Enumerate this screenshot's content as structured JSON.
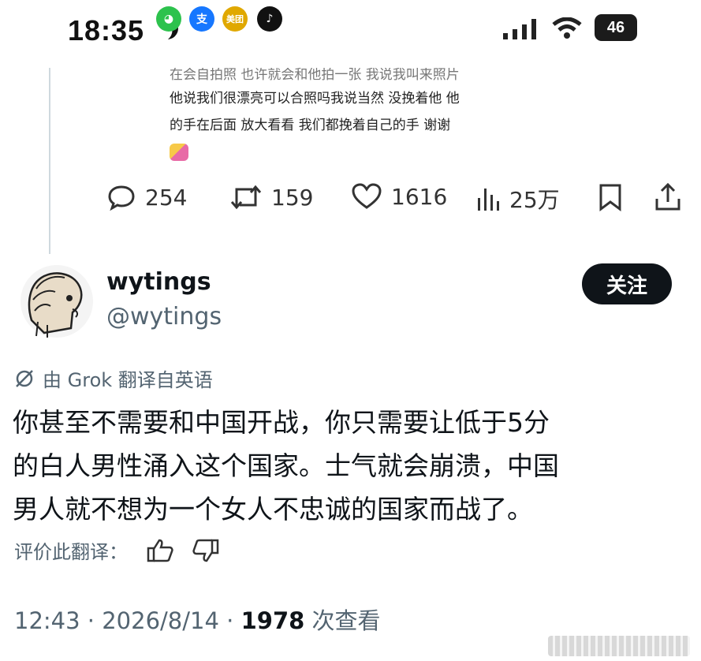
{
  "status_bar": {
    "time": "18:35",
    "apps": [
      {
        "name": "wechat-icon",
        "color": "#2dc24d",
        "glyph": "◕"
      },
      {
        "name": "alipay-icon",
        "color": "#1677ff",
        "glyph": "支"
      },
      {
        "name": "meituan-icon",
        "color": "#e0a800",
        "glyph": "美团"
      },
      {
        "name": "tiktok-icon",
        "color": "#111111",
        "glyph": "♪"
      }
    ],
    "battery": "46"
  },
  "quoted": {
    "line1_cut": "在会自拍照 也许就会和他拍一张 我说我叫来照片",
    "line2": "他说我们很漂亮可以合照吗我说当然 没挽着他 他",
    "line3": "的手在后面 放大看看 我们都挽着自己的手 谢谢"
  },
  "actions": {
    "replies": "254",
    "reposts": "159",
    "likes": "1616",
    "views": "25万"
  },
  "author": {
    "display_name": "wytings",
    "handle": "@wytings",
    "follow_label": "关注"
  },
  "translation": {
    "label": "由 Grok 翻译自英语",
    "text_line1": "你甚至不需要和中国开战，你只需要让低于5分",
    "text_line2": "的白人男性涌入这个国家。士气就会崩溃，中国",
    "text_line3": "男人就不想为一个女人不忠诚的国家而战了。",
    "rate_label": "评价此翻译："
  },
  "meta": {
    "time": "12:43",
    "sep1": " · ",
    "date": "2026/8/14",
    "sep2": " · ",
    "views": "1978",
    "views_suffix": " 次查看"
  }
}
